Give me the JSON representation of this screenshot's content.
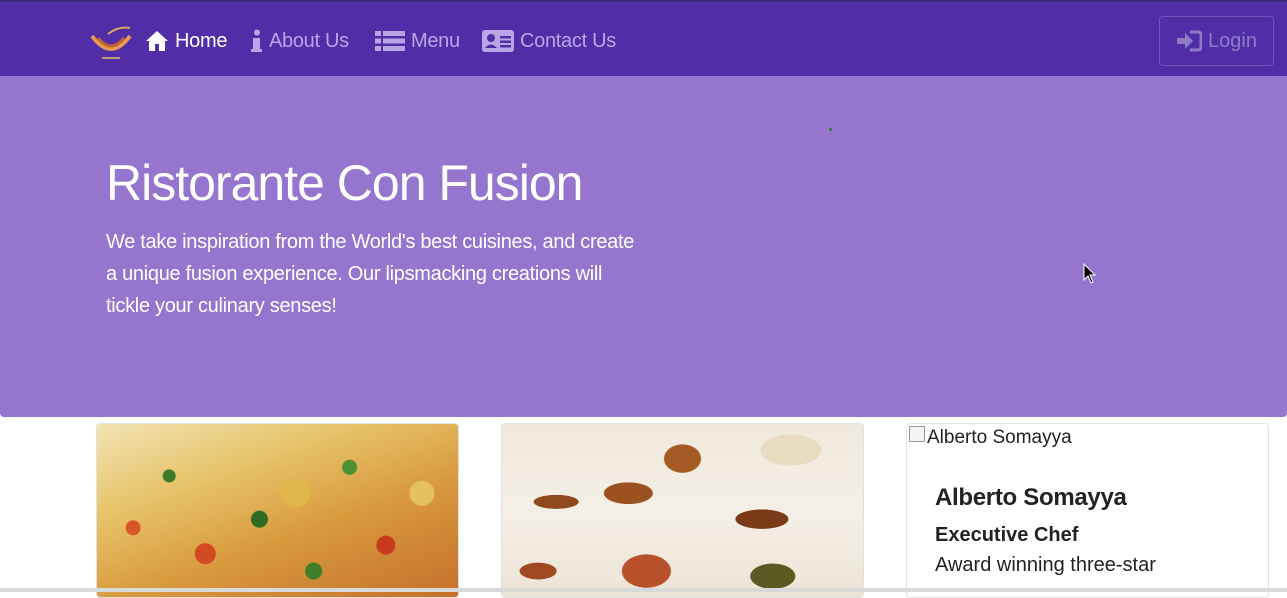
{
  "navbar": {
    "logo_icon": "restaurant-logo-icon",
    "items": [
      {
        "label": "Home",
        "icon": "home-icon",
        "active": true
      },
      {
        "label": "About Us",
        "icon": "info-icon",
        "active": false
      },
      {
        "label": "Menu",
        "icon": "list-icon",
        "active": false
      },
      {
        "label": "Contact Us",
        "icon": "address-card-icon",
        "active": false
      }
    ],
    "login_label": "Login",
    "login_icon": "sign-in-icon"
  },
  "jumbotron": {
    "title": "Ristorante Con Fusion",
    "text": "We take inspiration from the World's best cuisines, and create a unique fusion experience. Our lipsmacking creations will tickle your culinary senses!"
  },
  "cards": [
    {
      "image": "pizza-image"
    },
    {
      "image": "buffet-image"
    },
    {
      "image_alt": "Alberto Somayya",
      "name": "Alberto Somayya",
      "role": "Executive Chef",
      "description": "Award winning three-star"
    }
  ],
  "colors": {
    "navbar": "#512da8",
    "jumbotron": "#9575cd",
    "nav_inactive": "#b9a6e6",
    "nav_active": "#ffffff"
  }
}
